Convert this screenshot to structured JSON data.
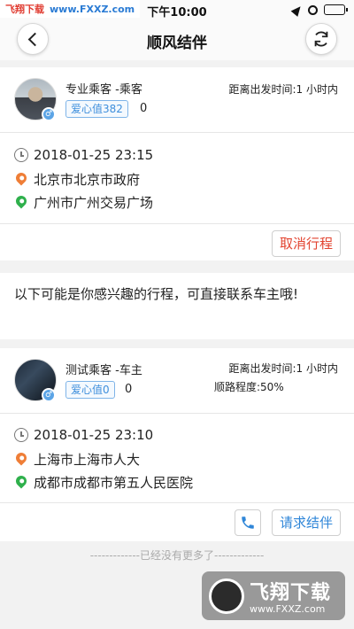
{
  "status_bar": {
    "time": "下午10:00"
  },
  "watermark_top": {
    "part1": "飞翔下载",
    "part2": "www.FXXZ.com"
  },
  "nav": {
    "title": "顺风结伴"
  },
  "my_trip": {
    "name": "专业乘客 -乘客",
    "love_label": "爱心值382",
    "love_extra": "0",
    "depart_in": "距离出发时间:1 小时内",
    "datetime": "2018-01-25 23:15",
    "from": "北京市北京市政府",
    "to": "广州市广州交易广场",
    "cancel_label": "取消行程"
  },
  "suggest_text": "以下可能是你感兴趣的行程，可直接联系车主哦!",
  "other_trip": {
    "name": "测试乘客 -车主",
    "love_label": "爱心值0",
    "love_extra": "0",
    "depart_in": "距离出发时间:1 小时内",
    "route_match": "顺路程度:50%",
    "datetime": "2018-01-25 23:10",
    "from": "上海市上海市人大",
    "to": "成都市成都市第五人民医院",
    "request_label": "请求结伴"
  },
  "no_more": "-------------已经没有更多了-------------",
  "watermark_bottom": {
    "title": "飞翔下载",
    "url": "www.FXXZ.com"
  },
  "colors": {
    "accent_blue": "#2f86d8",
    "cancel_red": "#e2432f",
    "pin_orange": "#ef7e37",
    "pin_green": "#2fb04c",
    "badge_blue": "#5ba4e6"
  },
  "icons": [
    "back-icon",
    "refresh-icon",
    "clock-icon",
    "origin-pin-icon",
    "destination-pin-icon",
    "phone-icon",
    "gender-male-icon",
    "location-arrow-icon",
    "alarm-icon",
    "battery-icon"
  ]
}
